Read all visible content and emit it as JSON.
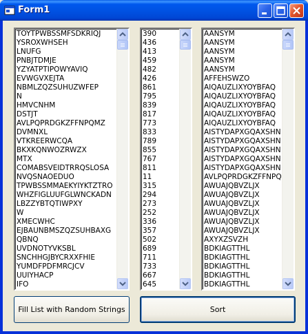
{
  "window": {
    "title": "Form1"
  },
  "titlebar_buttons": {
    "minimize": "minimize",
    "maximize": "maximize",
    "close": "close"
  },
  "list1": {
    "items": [
      "TOYTPWBSSMFSDKRIQJ",
      "YSROXWHSEH",
      "LNUFG",
      "PNBJTDMJE",
      "YZYATPTIPOWYAVIQ",
      "EVWGVXEJTA",
      "NBMLZQZSUHUZWFEP",
      "N",
      "HMVCNHM",
      "DSTJT",
      "AVLPQPRDGKZFFNPQMZ",
      "DVMNXL",
      "VTKREERWCQA",
      "BKXKQNWOZRWZX",
      "MTX",
      "COMABSVEIDTRRQSLOSA",
      "NVQSNAOEDUO",
      "TPWBSSMMAEKYIYKTZTRO",
      "WHZFIGLUUFGLWNCKADN",
      "LBZZYBTQTIWPXY",
      "W",
      "XMECWHC",
      "EJBAUNBMSZQZSUHBAXG",
      "QBNQ",
      "UVDNOTYVKSBL",
      "SNCHHGJBYCRXXFHIE",
      "YUMDFPDFMRCJCV",
      "UUIYHACP",
      "IFO"
    ]
  },
  "list2": {
    "items": [
      "390",
      "436",
      "413",
      "459",
      "482",
      "426",
      "861",
      "795",
      "839",
      "817",
      "773",
      "833",
      "789",
      "855",
      "767",
      "811",
      "11",
      "315",
      "294",
      "273",
      "252",
      "336",
      "357",
      "502",
      "689",
      "711",
      "733",
      "667",
      "645"
    ]
  },
  "list3": {
    "items": [
      "AANSYM",
      "AANSYM",
      "AANSYM",
      "AANSYM",
      "AANSYM",
      "AFFEHSWZO",
      "AIQAUZLIXYOYBFAQ",
      "AIQAUZLIXYOYBFAQ",
      "AIQAUZLIXYOYBFAQ",
      "AIQAUZLIXYOYBFAQ",
      "AIQAUZLIXYOYBFAQ",
      "AISTYDAPXGQAXSHN",
      "AISTYDAPXGQAXSHN",
      "AISTYDAPXGQAXSHN",
      "AISTYDAPXGQAXSHN",
      "AISTYDAPXGQAXSHN",
      "AVLPQPRDGKZFFNPQ",
      "AWUAJQBVZLJX",
      "AWUAJQBVZLJX",
      "AWUAJQBVZLJX",
      "AWUAJQBVZLJX",
      "AWUAJQBVZLJX",
      "AWUAJQBVZLJX",
      "AXYXZSVZH",
      "BDKIAGTTHL",
      "BDKIAGTTHL",
      "BDKIAGTTHL",
      "BDKIAGTTHL",
      "BDKIAGTTHL"
    ]
  },
  "buttons": {
    "fill": "Fill List with Random  Strings",
    "sort": "Sort"
  },
  "colors": {
    "titlebar": "#0054e3",
    "face": "#ece9d8",
    "close": "#e2562e"
  }
}
